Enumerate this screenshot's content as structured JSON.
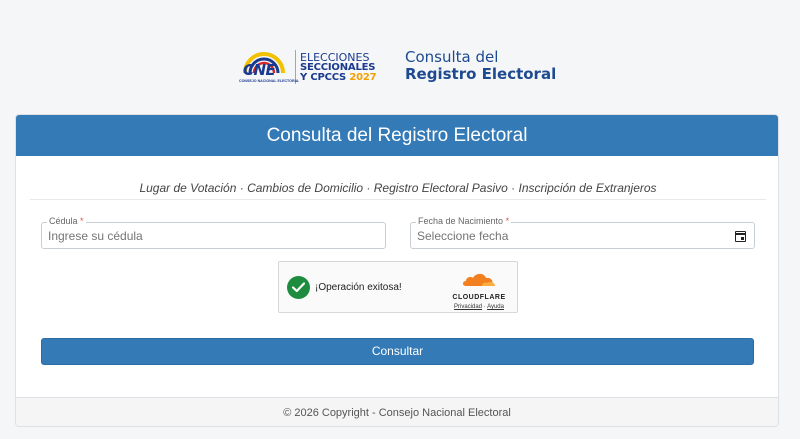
{
  "header": {
    "logo": {
      "abbr": "CNE",
      "subtitle": "CONSEJO NACIONAL ELECTORAL",
      "line1": "ELECCIONES",
      "line2": "SECCIONALES",
      "line3": "Y CPCCS",
      "year": "2027"
    },
    "title_line1": "Consulta del",
    "title_line2": "Registro Electoral"
  },
  "card": {
    "heading": "Consulta del Registro Electoral",
    "subtitle": "Lugar de Votación · Cambios de Domicilio · Registro Electoral Pasivo · Inscripción de Extranjeros",
    "cedula": {
      "label": "Cédula",
      "required_mark": "*",
      "placeholder": "Ingrese su cédula",
      "value": ""
    },
    "fecha": {
      "label": "Fecha de Nacimiento",
      "required_mark": "*",
      "placeholder": "Seleccione fecha",
      "value": ""
    },
    "captcha": {
      "message": "¡Operación exitosa!",
      "brand": "CLOUDFLARE",
      "privacy_link": "Privacidad",
      "separator": "·",
      "help_link": "Ayuda"
    },
    "submit_label": "Consultar",
    "footer": "© 2026 Copyright - Consejo Nacional Electoral"
  },
  "colors": {
    "primary": "#337ab7",
    "brand_blue": "#1a3a8f",
    "accent_yellow": "#f2a100",
    "success_green": "#1d8c3f",
    "cloudflare_orange": "#f38020"
  }
}
